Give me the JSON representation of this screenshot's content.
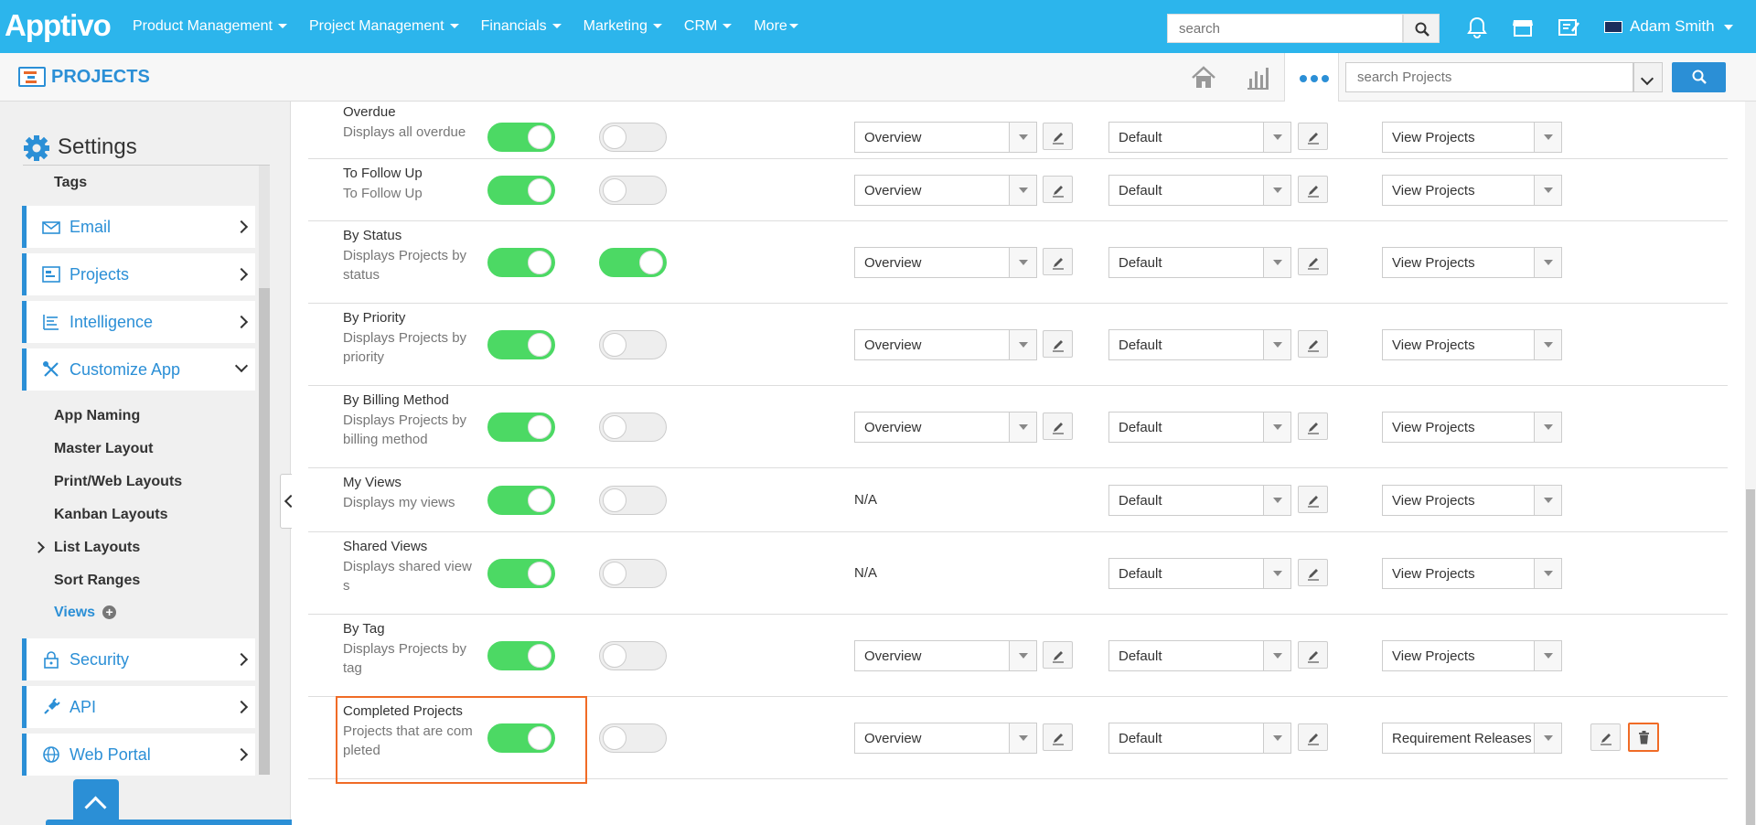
{
  "nav": {
    "logo": "Apptivo",
    "menu": [
      {
        "label": "Product Management"
      },
      {
        "label": "Project Management"
      },
      {
        "label": "Financials"
      },
      {
        "label": "Marketing"
      },
      {
        "label": "CRM"
      },
      {
        "label": "More"
      }
    ],
    "search_placeholder": "search",
    "user_name": "Adam Smith"
  },
  "header": {
    "app_title": "PROJECTS",
    "search_placeholder": "search Projects"
  },
  "sidebar": {
    "title": "Settings",
    "tags_label": "Tags",
    "items": [
      {
        "label": "Email",
        "icon": "email-icon"
      },
      {
        "label": "Projects",
        "icon": "projects-icon"
      },
      {
        "label": "Intelligence",
        "icon": "intelligence-icon"
      },
      {
        "label": "Customize App",
        "icon": "tools-icon"
      },
      {
        "label": "Security",
        "icon": "lock-icon"
      },
      {
        "label": "API",
        "icon": "plug-icon"
      },
      {
        "label": "Web Portal",
        "icon": "globe-icon"
      }
    ],
    "customize_sub": [
      {
        "label": "App Naming"
      },
      {
        "label": "Master Layout"
      },
      {
        "label": "Print/Web Layouts"
      },
      {
        "label": "Kanban Layouts"
      },
      {
        "label": "List Layouts"
      },
      {
        "label": "Sort Ranges"
      },
      {
        "label": "Views"
      }
    ]
  },
  "views": [
    {
      "title": "Overdue",
      "desc": "Displays all overdue",
      "toggle1": true,
      "toggle2": false,
      "layout": "Overview",
      "theme": "Default",
      "action": "View Projects"
    },
    {
      "title": "To Follow Up",
      "desc": "To Follow Up",
      "toggle1": true,
      "toggle2": false,
      "layout": "Overview",
      "theme": "Default",
      "action": "View Projects"
    },
    {
      "title": "By Status",
      "desc": "Displays Projects by status",
      "toggle1": true,
      "toggle2": true,
      "layout": "Overview",
      "theme": "Default",
      "action": "View Projects"
    },
    {
      "title": "By Priority",
      "desc": "Displays Projects by priority",
      "toggle1": true,
      "toggle2": false,
      "layout": "Overview",
      "theme": "Default",
      "action": "View Projects"
    },
    {
      "title": "By Billing Method",
      "desc": "Displays Projects by billing method",
      "toggle1": true,
      "toggle2": false,
      "layout": "Overview",
      "theme": "Default",
      "action": "View Projects"
    },
    {
      "title": "My Views",
      "desc": "Displays my views",
      "toggle1": true,
      "toggle2": false,
      "layout": "N/A",
      "theme": "Default",
      "action": "View Projects"
    },
    {
      "title": "Shared Views",
      "desc": "Displays shared view s",
      "toggle1": true,
      "toggle2": false,
      "layout": "N/A",
      "theme": "Default",
      "action": "View Projects"
    },
    {
      "title": "By Tag",
      "desc": "Displays Projects by tag",
      "toggle1": true,
      "toggle2": false,
      "layout": "Overview",
      "theme": "Default",
      "action": "View Projects"
    },
    {
      "title": "Completed Projects",
      "desc": "Projects that are com pleted",
      "toggle1": true,
      "toggle2": false,
      "layout": "Overview",
      "theme": "Default",
      "action": "Requirement Releases"
    }
  ]
}
